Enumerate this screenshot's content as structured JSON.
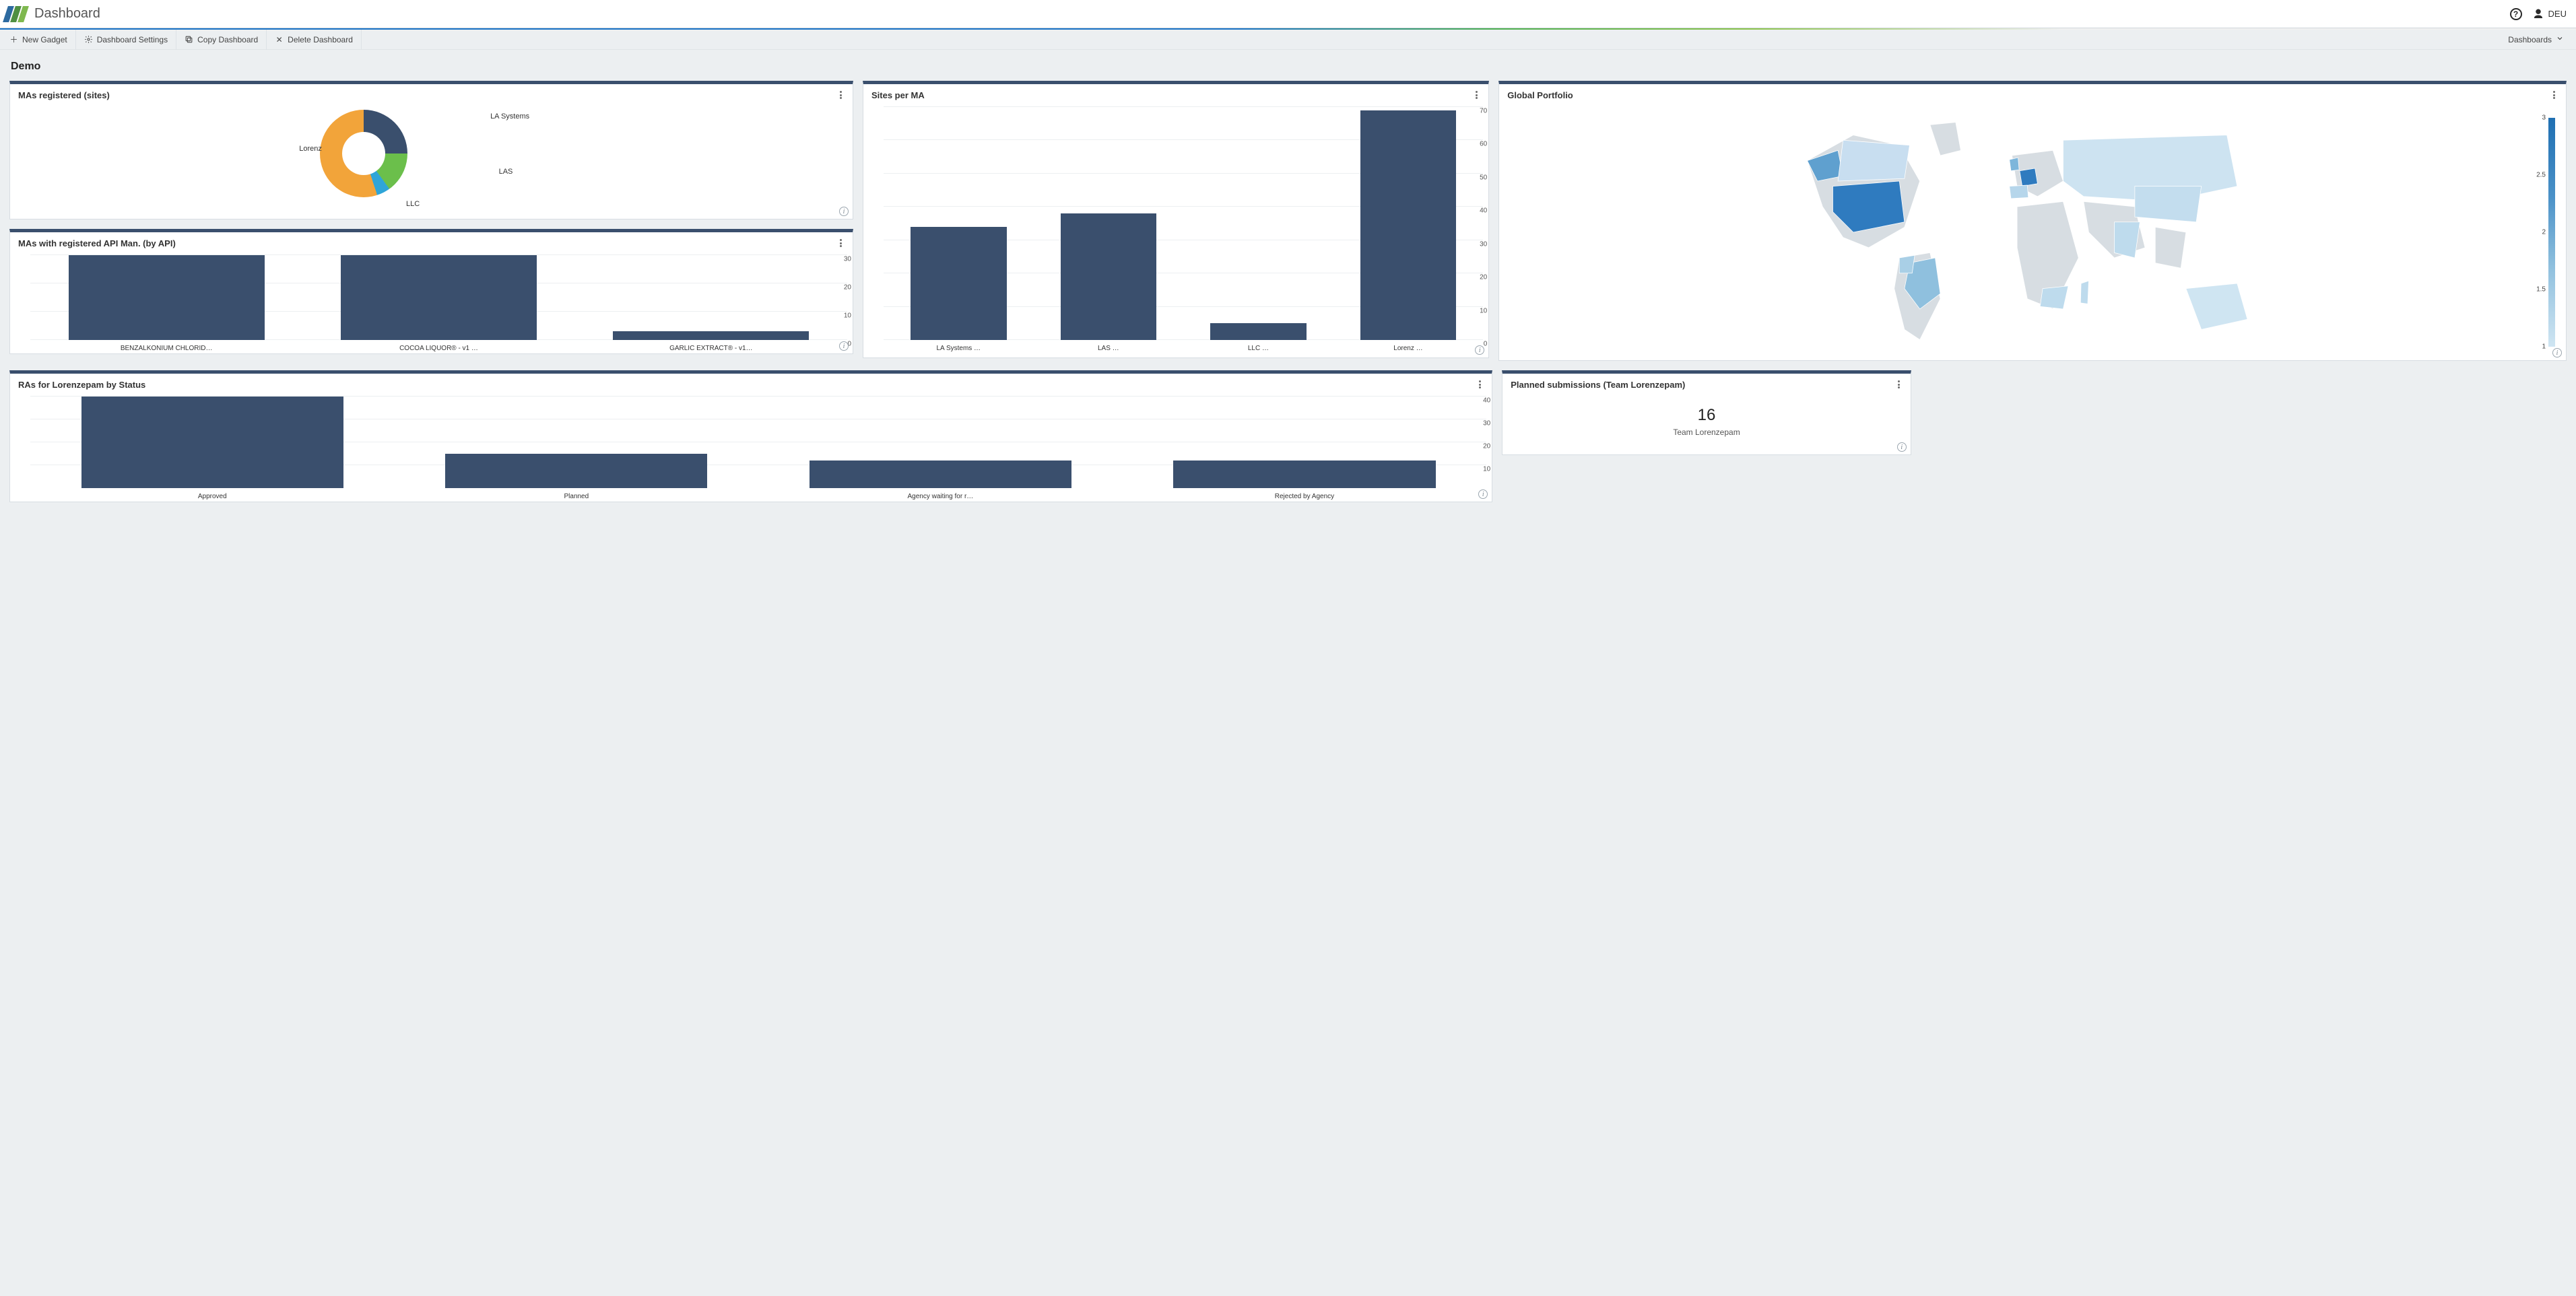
{
  "header": {
    "title": "Dashboard",
    "user_label": "DEU"
  },
  "toolbar": {
    "items": [
      {
        "icon": "plus",
        "label": "New Gadget"
      },
      {
        "icon": "gear",
        "label": "Dashboard Settings"
      },
      {
        "icon": "copy",
        "label": "Copy Dashboard"
      },
      {
        "icon": "close",
        "label": "Delete Dashboard"
      }
    ],
    "right_label": "Dashboards"
  },
  "page_title": "Demo",
  "gadgets": {
    "donut": {
      "title": "MAs registered (sites)",
      "labels": [
        "LA Systems",
        "LAS",
        "LLC",
        "Lorenz"
      ]
    },
    "api_bar": {
      "title": "MAs with registered API Man. (by API)"
    },
    "sites_bar": {
      "title": "Sites per MA"
    },
    "map": {
      "title": "Global Portfolio"
    },
    "status_bar": {
      "title": "RAs for Lorenzepam by Status"
    },
    "kpi": {
      "title": "Planned submissions (Team Lorenzepam)",
      "value": "16",
      "label": "Team Lorenzepam"
    }
  },
  "chart_data": [
    {
      "id": "donut",
      "type": "pie",
      "title": "MAs registered (sites)",
      "series": [
        {
          "name": "LA Systems",
          "value": 25,
          "color": "#3a4f6d"
        },
        {
          "name": "LAS",
          "value": 15,
          "color": "#6bbf4b"
        },
        {
          "name": "LLC",
          "value": 5,
          "color": "#2fa5d8"
        },
        {
          "name": "Lorenz",
          "value": 55,
          "color": "#f2a43a"
        }
      ]
    },
    {
      "id": "api_bar",
      "type": "bar",
      "title": "MAs with registered API Man. (by API)",
      "categories": [
        "BENZALKONIUM CHLORID…",
        "COCOA LIQUOR® - v1 …",
        "GARLIC EXTRACT® - v1…"
      ],
      "values": [
        30,
        30,
        3
      ],
      "ylim": [
        0,
        30
      ],
      "yticks": [
        0,
        10,
        20,
        30
      ]
    },
    {
      "id": "sites_bar",
      "type": "bar",
      "title": "Sites per MA",
      "categories": [
        "LA Systems …",
        "LAS …",
        "LLC …",
        "Lorenz …"
      ],
      "values": [
        34,
        38,
        5,
        69
      ],
      "ylim": [
        0,
        70
      ],
      "yticks": [
        0,
        10,
        20,
        30,
        40,
        50,
        60,
        70
      ]
    },
    {
      "id": "status_bar",
      "type": "bar",
      "title": "RAs for Lorenzepam by Status",
      "categories": [
        "Approved",
        "Planned",
        "Agency waiting for r…",
        "Rejected by Agency"
      ],
      "values": [
        42,
        15,
        12,
        12
      ],
      "ylim": [
        0,
        40
      ],
      "yticks": [
        10,
        20,
        30,
        40
      ]
    },
    {
      "id": "map",
      "type": "heatmap",
      "title": "Global Portfolio",
      "scale": {
        "min": 1,
        "max": 3,
        "ticks": [
          3,
          2.5,
          2,
          1.5,
          1
        ]
      }
    },
    {
      "id": "kpi",
      "type": "table",
      "title": "Planned submissions (Team Lorenzepam)",
      "value": 16,
      "label": "Team Lorenzepam"
    }
  ]
}
